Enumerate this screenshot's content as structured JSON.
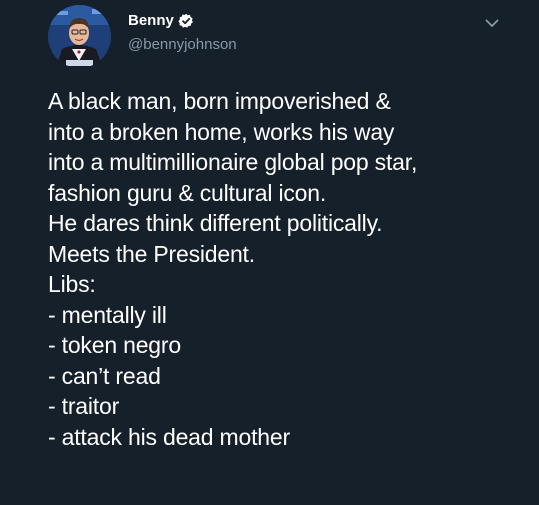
{
  "author": {
    "display_name": "Benny",
    "handle": "@bennyjohnson",
    "verified": true
  },
  "icons": {
    "verified": "verified-badge-icon",
    "more": "chevron-down-icon"
  },
  "colors": {
    "background": "#15202b",
    "text": "#ffffff",
    "secondary_text": "#8899a6"
  },
  "tweet": {
    "lines": [
      "A black man, born impoverished &",
      "into a broken home, works his way",
      "into a multimillionaire global pop star,",
      "fashion guru & cultural icon.",
      "He dares think different politically.",
      "Meets the President.",
      "Libs:",
      "- mentally ill",
      "- token negro",
      "- can’t read",
      "- traitor",
      "- attack his dead mother"
    ]
  }
}
